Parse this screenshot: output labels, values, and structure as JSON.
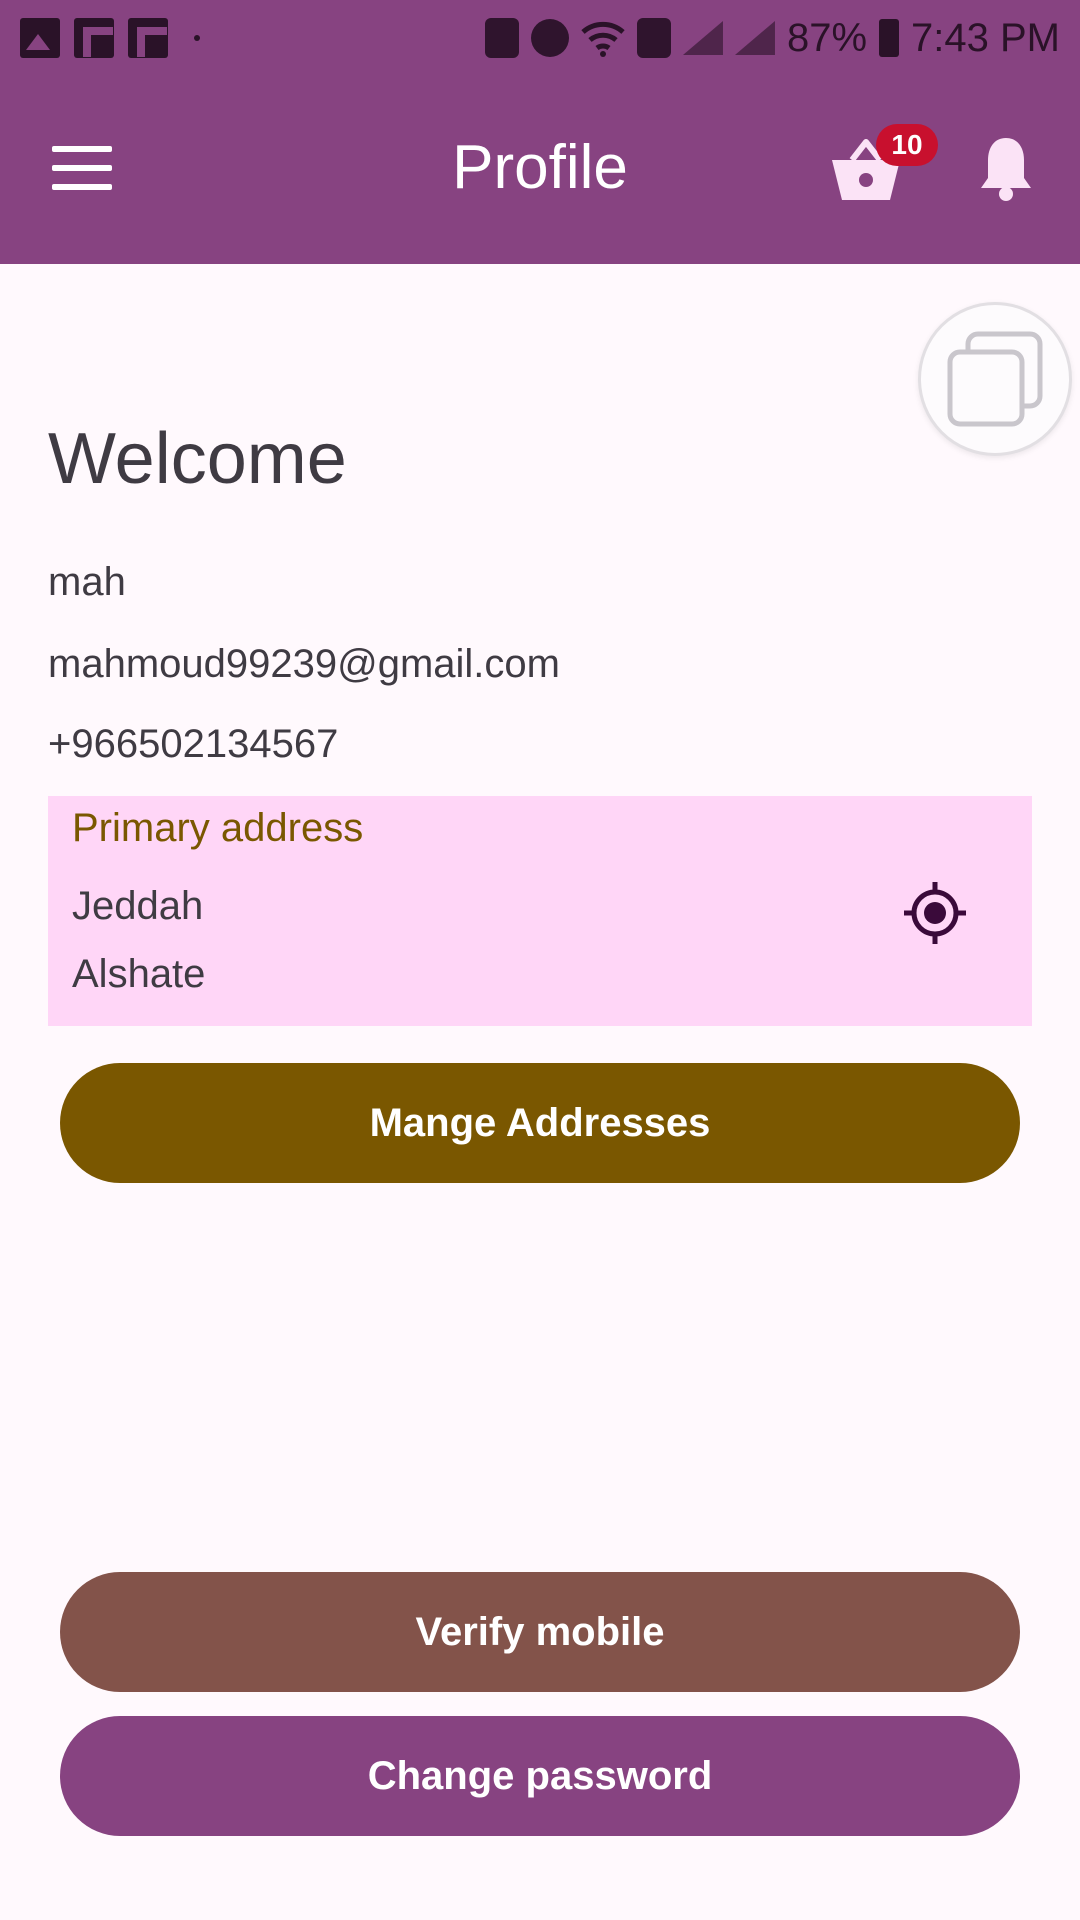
{
  "status_bar": {
    "battery": "87%",
    "time": "7:43 PM",
    "left_icons": [
      "image-icon",
      "flipboard-icon",
      "flipboard-icon"
    ],
    "right_icons": [
      "recycle-icon",
      "alarm-icon",
      "wifi-icon",
      "sim-icon",
      "signal-icon",
      "signal-icon",
      "battery-icon"
    ]
  },
  "app_bar": {
    "title": "Profile",
    "menu_icon": "hamburger-menu-icon",
    "cart_icon": "shopping-basket-icon",
    "cart_count": "10",
    "bell_icon": "notification-bell-icon"
  },
  "floating_button": {
    "icon": "copy-windows-icon"
  },
  "profile": {
    "welcome": "Welcome",
    "name": "mah",
    "email": "mahmoud99239@gmail.com",
    "phone": "+966502134567"
  },
  "address": {
    "title": "Primary address",
    "line1": "Jeddah",
    "line2": "Alshate",
    "locate_icon": "gps-target-icon"
  },
  "buttons": {
    "manage_addresses": "Mange Addresses",
    "verify_mobile": "Verify mobile",
    "change_password": "Change password"
  },
  "colors": {
    "primary": "#874381",
    "gold": "#7a5700",
    "brown": "#83534a",
    "address_bg": "#ffd6f7",
    "badge": "#c8102e"
  }
}
